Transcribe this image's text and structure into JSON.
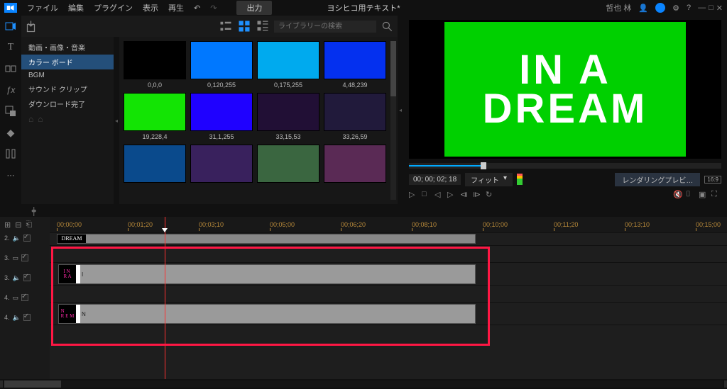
{
  "app": {
    "title": "ヨシヒコ用テキスト*",
    "user": "哲也 林",
    "output_label": "出力"
  },
  "menu": {
    "file": "ファイル",
    "edit": "編集",
    "plugin": "プラグイン",
    "view": "表示",
    "play": "再生"
  },
  "library": {
    "search_placeholder": "ライブラリーの検索",
    "tree": {
      "root": "動画・画像・音楽",
      "items": [
        "カラー ボード",
        "BGM",
        "サウンド クリップ",
        "ダウンロード完了"
      ]
    },
    "swatches": [
      {
        "label": "0,0,0",
        "color": "#000000"
      },
      {
        "label": "0,120,255",
        "color": "#0078ff"
      },
      {
        "label": "0,175,255",
        "color": "#00aaee"
      },
      {
        "label": "4,48,239",
        "color": "#0430ef"
      },
      {
        "label": "19,228,4",
        "color": "#13e404"
      },
      {
        "label": "31,1,255",
        "color": "#1f01ff"
      },
      {
        "label": "33,15,53",
        "color": "#210f35"
      },
      {
        "label": "33,26,59",
        "color": "#211a3b"
      },
      {
        "label": "",
        "color": "#0a4a8c"
      },
      {
        "label": "",
        "color": "#39215d"
      },
      {
        "label": "",
        "color": "#3a6640"
      },
      {
        "label": "",
        "color": "#5a2a55"
      }
    ]
  },
  "preview": {
    "text_line1": "IN A",
    "text_line2": "DREAM",
    "timecode": "00; 00; 02; 18",
    "fit_label": "フィット",
    "render_label": "レンダリングプレビ…"
  },
  "timeline": {
    "ticks": [
      "00;00;00",
      "00;01;20",
      "00;03;10",
      "00;05;00",
      "00;06;20",
      "00;08;10",
      "00;10;00",
      "00;11;20",
      "00;13;10",
      "00;15;00"
    ],
    "tracks": [
      {
        "n": "",
        "type": "ruler"
      },
      {
        "n": "",
        "clip": true,
        "thumb": "DREAM",
        "hasthumb": true,
        "h": 18,
        "header": false
      },
      {
        "n": "2.",
        "icon": "audio",
        "chk": true,
        "clip": false,
        "sm": true
      },
      {
        "n": "3.",
        "icon": "video",
        "chk": true,
        "clip": true,
        "thumb": "IN A"
      },
      {
        "n": "3.",
        "icon": "audio",
        "chk": true,
        "clip": false,
        "sm": true
      },
      {
        "n": "4.",
        "icon": "video",
        "chk": true,
        "clip": true,
        "thumb": "DREAM"
      },
      {
        "n": "4.",
        "icon": "audio",
        "chk": true,
        "clip": false,
        "sm": true
      }
    ]
  }
}
